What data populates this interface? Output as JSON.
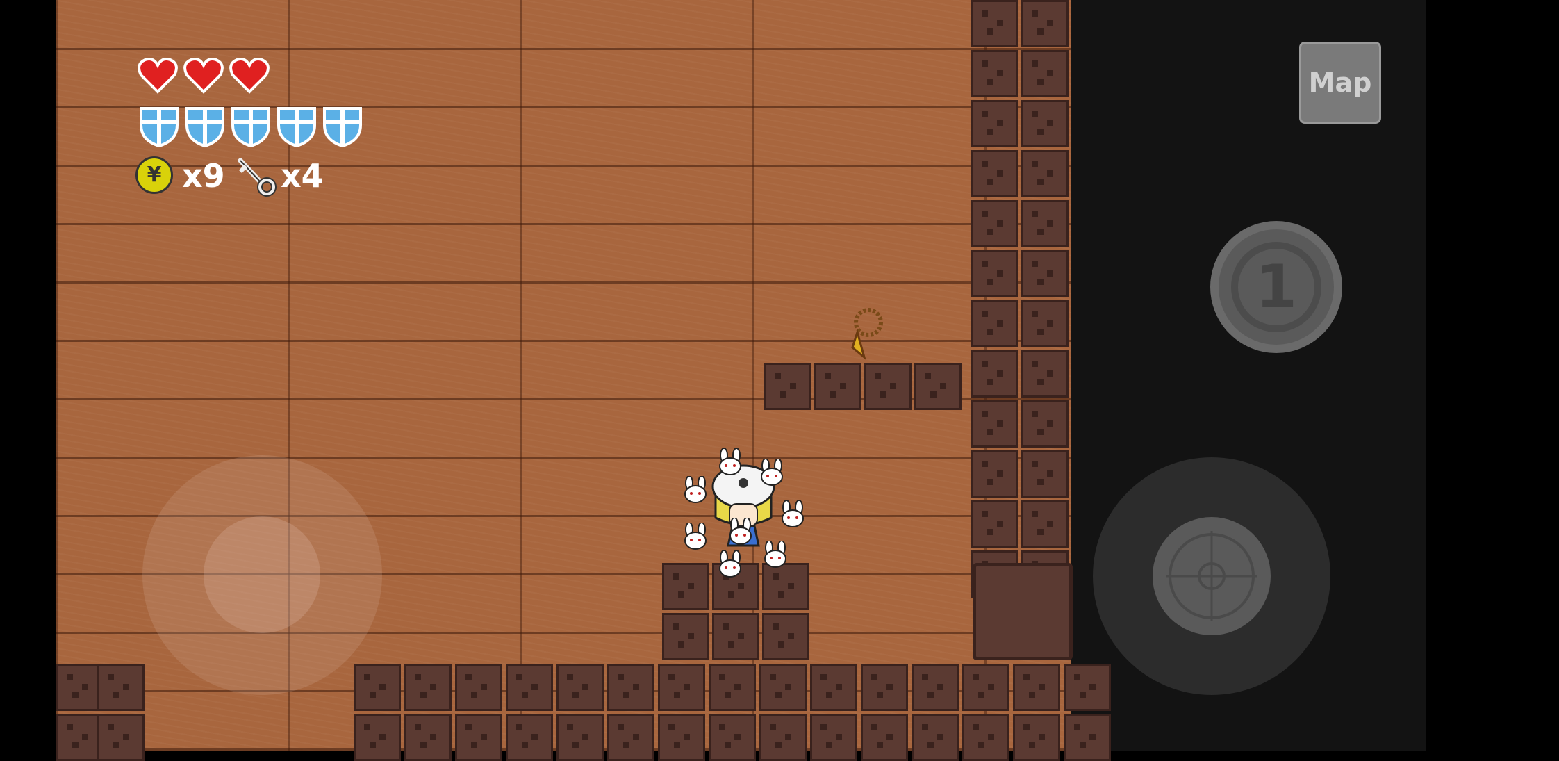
{
  "hud": {
    "hearts": 3,
    "shields": 5,
    "coins_label": "x9",
    "keys_label": "x4",
    "coin_symbol": "¥"
  },
  "controls": {
    "map_label": "Map",
    "skill_label": "1"
  },
  "colors": {
    "wood": "#a8663e",
    "block": "#5b3a32",
    "heart": "#e02020",
    "shield": "#5bb0e6",
    "coin": "#d9d20a"
  },
  "icons": [
    "heart-icon",
    "shield-icon",
    "yen-coin-icon",
    "key-icon",
    "map-button",
    "skill-button",
    "aim-joystick",
    "move-joystick",
    "prayer-beads-item",
    "player-character"
  ]
}
